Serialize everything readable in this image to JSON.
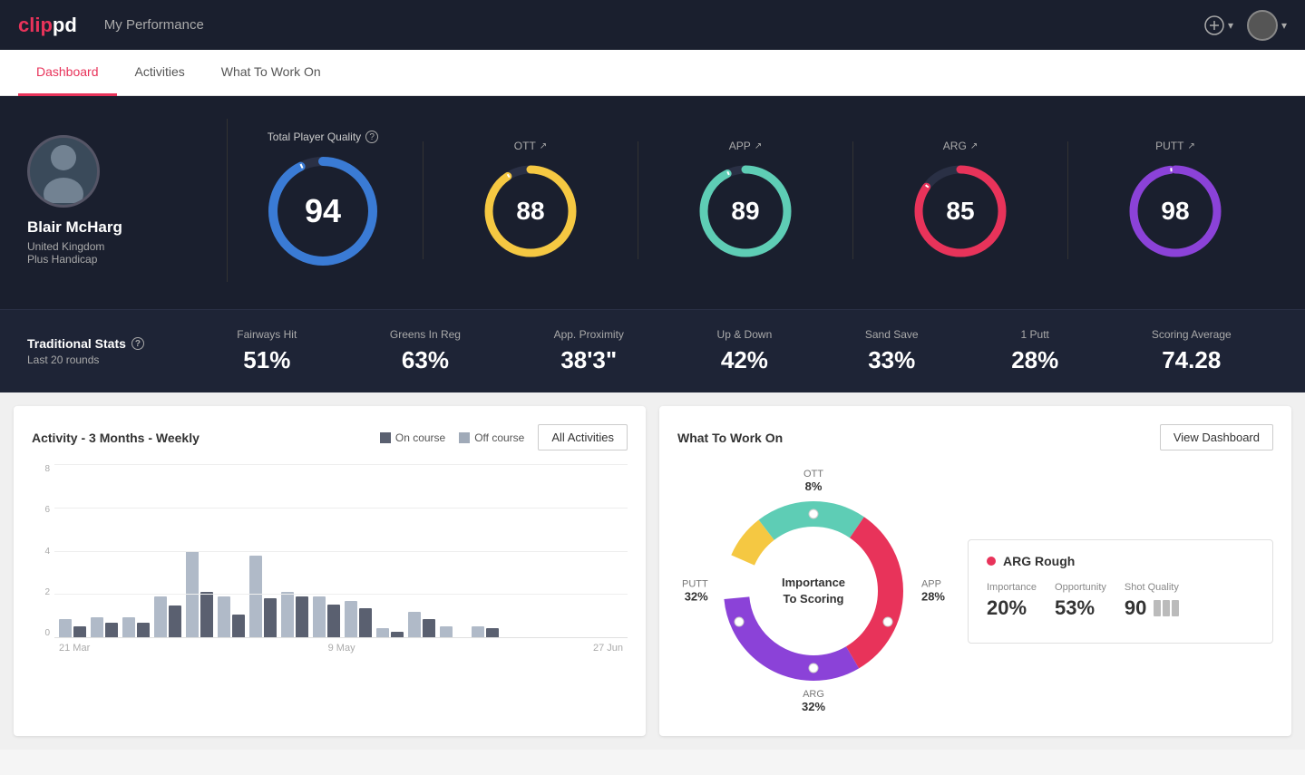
{
  "app": {
    "logo_clip": "clip",
    "logo_pd": "pd",
    "header_title": "My Performance"
  },
  "nav": {
    "tabs": [
      "Dashboard",
      "Activities",
      "What To Work On"
    ],
    "active": "Dashboard"
  },
  "player": {
    "name": "Blair McHarg",
    "country": "United Kingdom",
    "handicap": "Plus Handicap"
  },
  "scores": {
    "tpq_label": "Total Player Quality",
    "tpq_value": "94",
    "ott_label": "OTT",
    "ott_value": "88",
    "app_label": "APP",
    "app_value": "89",
    "arg_label": "ARG",
    "arg_value": "85",
    "putt_label": "PUTT",
    "putt_value": "98"
  },
  "traditional_stats": {
    "label": "Traditional Stats",
    "sublabel": "Last 20 rounds",
    "fairways_hit_label": "Fairways Hit",
    "fairways_hit_value": "51%",
    "greens_in_reg_label": "Greens In Reg",
    "greens_in_reg_value": "63%",
    "app_proximity_label": "App. Proximity",
    "app_proximity_value": "38'3\"",
    "up_down_label": "Up & Down",
    "up_down_value": "42%",
    "sand_save_label": "Sand Save",
    "sand_save_value": "33%",
    "one_putt_label": "1 Putt",
    "one_putt_value": "28%",
    "scoring_avg_label": "Scoring Average",
    "scoring_avg_value": "74.28"
  },
  "activity_chart": {
    "title": "Activity - 3 Months - Weekly",
    "legend_on_course": "On course",
    "legend_off_course": "Off course",
    "all_activities_btn": "All Activities",
    "x_labels": [
      "21 Mar",
      "9 May",
      "27 Jun"
    ],
    "y_labels": [
      "8",
      "6",
      "4",
      "2",
      "0"
    ],
    "bars": [
      {
        "dark": 12,
        "light": 20
      },
      {
        "dark": 15,
        "light": 20
      },
      {
        "dark": 14,
        "light": 20
      },
      {
        "dark": 30,
        "light": 40
      },
      {
        "dark": 45,
        "light": 85
      },
      {
        "dark": 22,
        "light": 40
      },
      {
        "dark": 38,
        "light": 80
      },
      {
        "dark": 40,
        "light": 45
      },
      {
        "dark": 32,
        "light": 40
      },
      {
        "dark": 28,
        "light": 35
      },
      {
        "dark": 5,
        "light": 8
      },
      {
        "dark": 18,
        "light": 25
      },
      {
        "dark": 0,
        "light": 10
      },
      {
        "dark": 8,
        "light": 10
      }
    ]
  },
  "what_to_work_on": {
    "title": "What To Work On",
    "view_dashboard_btn": "View Dashboard",
    "donut_center_line1": "Importance",
    "donut_center_line2": "To Scoring",
    "segments": [
      {
        "label": "OTT",
        "pct": "8%",
        "color": "#f5c842"
      },
      {
        "label": "APP",
        "pct": "28%",
        "color": "#5ecdb5"
      },
      {
        "label": "ARG",
        "pct": "32%",
        "color": "#e8335a"
      },
      {
        "label": "PUTT",
        "pct": "32%",
        "color": "#7b42c8"
      }
    ],
    "info_card": {
      "title": "ARG Rough",
      "importance_label": "Importance",
      "importance_value": "20%",
      "opportunity_label": "Opportunity",
      "opportunity_value": "53%",
      "shot_quality_label": "Shot Quality",
      "shot_quality_value": "90"
    }
  }
}
